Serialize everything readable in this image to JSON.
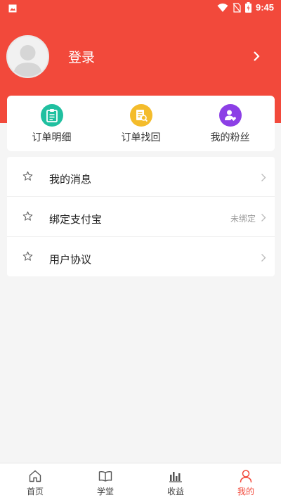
{
  "status_bar": {
    "time": "9:45"
  },
  "profile": {
    "login_label": "登录"
  },
  "quick_actions": [
    {
      "label": "订单明细",
      "icon": "clipboard-icon",
      "color": "#20c0a0"
    },
    {
      "label": "订单找回",
      "icon": "document-search-icon",
      "color": "#f4bc2b"
    },
    {
      "label": "我的粉丝",
      "icon": "users-heart-icon",
      "color": "#8c3fe6"
    }
  ],
  "menu": [
    {
      "label": "我的消息",
      "value": ""
    },
    {
      "label": "绑定支付宝",
      "value": "未绑定"
    },
    {
      "label": "用户协议",
      "value": ""
    }
  ],
  "bottom_nav": [
    {
      "label": "首页",
      "icon": "home-icon"
    },
    {
      "label": "学堂",
      "icon": "book-icon"
    },
    {
      "label": "收益",
      "icon": "bar-chart-icon"
    },
    {
      "label": "我的",
      "icon": "user-icon",
      "active": true
    }
  ],
  "colors": {
    "accent": "#f2493b"
  }
}
